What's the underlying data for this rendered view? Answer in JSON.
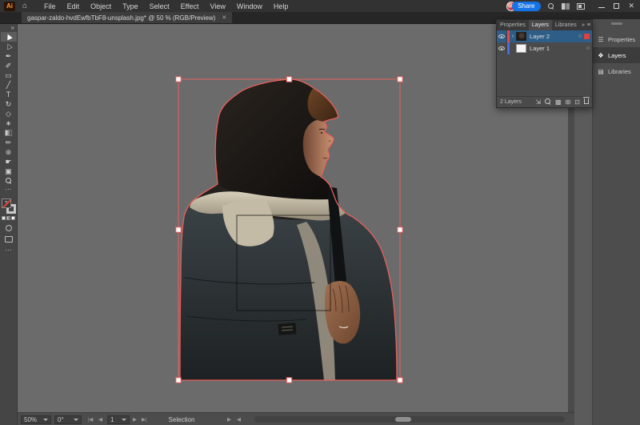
{
  "titlebar": {
    "app_icon_label": "Ai",
    "menus": [
      "File",
      "Edit",
      "Object",
      "Type",
      "Select",
      "Effect",
      "View",
      "Window",
      "Help"
    ],
    "share_label": "Share",
    "close_glyph": "✕"
  },
  "tabbar": {
    "active_tab_title": "gaspar-zaldo-hvdEwfbTbF8-unsplash.jpg* @ 50 % (RGB/Preview)",
    "tab_close_glyph": "✕"
  },
  "toolbar": {
    "collapse_glyph": "»",
    "more_glyph": "⋯",
    "dots_glyph": "⋯",
    "fill_none_glyph": "?",
    "tools": [
      {
        "name": "selection-tool",
        "glyph": "▶",
        "rot": -115,
        "active": true
      },
      {
        "name": "direct-selection-tool",
        "glyph": "▷",
        "rot": -115
      },
      {
        "name": "pen-tool",
        "glyph": "✒"
      },
      {
        "name": "curvature-tool",
        "glyph": "✐"
      },
      {
        "name": "rectangle-tool",
        "glyph": "▭"
      },
      {
        "name": "line-segment-tool",
        "glyph": "╱"
      },
      {
        "name": "type-tool",
        "glyph": "T"
      },
      {
        "name": "rotate-tool",
        "glyph": "↻"
      },
      {
        "name": "shape-builder-tool",
        "glyph": "◇"
      },
      {
        "name": "free-transform-tool",
        "glyph": "∗"
      },
      {
        "name": "gradient-tool",
        "css": "gradient-swatch"
      },
      {
        "name": "eyedropper-tool",
        "glyph": "✏"
      },
      {
        "name": "blend-tool",
        "glyph": "⊛"
      },
      {
        "name": "hand-tool",
        "glyph": "☛"
      },
      {
        "name": "artboard-tool",
        "glyph": "▣"
      },
      {
        "name": "zoom-tool",
        "css": "zoom-glass"
      }
    ]
  },
  "layers_panel": {
    "tabs": [
      {
        "label": "Properties",
        "active": false
      },
      {
        "label": "Layers",
        "active": true
      },
      {
        "label": "Libraries",
        "active": false
      }
    ],
    "collapse_glyph": "»",
    "menu_glyph": "≡",
    "expand_glyph": "›",
    "target_glyph": "○",
    "rows": [
      {
        "name": "Layer 2",
        "color": "#e04b4b",
        "selected": true,
        "expandable": true,
        "thumb": "image"
      },
      {
        "name": "Layer 1",
        "color": "#4a6fd6",
        "selected": false,
        "expandable": false,
        "thumb": "white"
      }
    ],
    "status": "2 Layers",
    "bottom_icons": [
      {
        "name": "collect-for-export-icon",
        "glyph": "⇲"
      },
      {
        "name": "locate-object-icon",
        "css": "zoom-glass"
      },
      {
        "name": "make-mask-icon",
        "glyph": "▩"
      },
      {
        "name": "new-sublayer-icon",
        "glyph": "⊞"
      },
      {
        "name": "new-layer-icon",
        "glyph": "⊡"
      },
      {
        "name": "delete-layer-icon",
        "css": "trash"
      }
    ]
  },
  "dock": {
    "items": [
      {
        "label": "Properties",
        "name": "dock-properties",
        "glyph": "☰",
        "active": false
      },
      {
        "label": "Layers",
        "name": "dock-layers",
        "glyph": "❖",
        "active": true
      },
      {
        "label": "Libraries",
        "name": "dock-libraries",
        "glyph": "▤",
        "active": false
      }
    ]
  },
  "statusbar": {
    "zoom": "50%",
    "rotation": "0°",
    "artboard": "1",
    "status": "Selection",
    "nav": {
      "first": "|◀",
      "prev": "◀",
      "next": "▶",
      "last": "▶|"
    },
    "extra": {
      "next": "▶",
      "prev": "◀"
    }
  },
  "colors": {
    "selection_red": "#e8605c",
    "share_blue": "#1473e6",
    "canvas_bg": "#6b6b6b",
    "selected_row_blue": "#2e5d87"
  }
}
